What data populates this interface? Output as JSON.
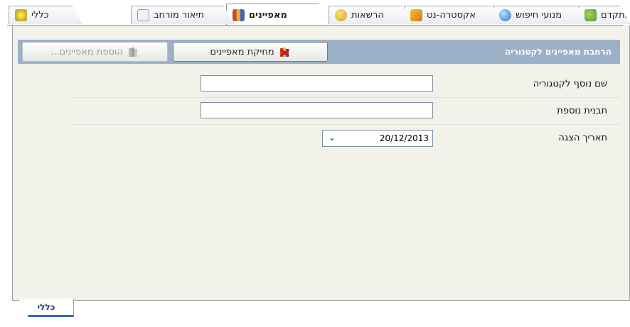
{
  "tabs": [
    {
      "label": "מתקדם",
      "icon": "puzzle-icon",
      "color": "#7fb83a"
    },
    {
      "label": "מנועי חיפוש",
      "icon": "globe-icon",
      "color": "#3a7fd0"
    },
    {
      "label": "אקסטרה-נט",
      "icon": "network-icon",
      "color": "#d99a20"
    },
    {
      "label": "הרשאות",
      "icon": "lock-icon",
      "color": "#e0b030"
    },
    {
      "label": "מאפיינים",
      "icon": "books-icon",
      "color": "#c04a2a"
    },
    {
      "label": "תיאור מורחב",
      "icon": "notepad-pencil-icon",
      "color": "#8a9ab0"
    },
    {
      "label": "כללי",
      "icon": "sparkle-icon",
      "color": "#e0c020"
    }
  ],
  "active_tab": "מאפיינים",
  "panel": {
    "title": "הרחבת מאפיינים לקטגוריה",
    "delete_button": "מחיקת מאפיינים",
    "add_button": "הוספת מאפיינים..."
  },
  "fields": {
    "extra_name": {
      "label": "שם נוסף לקטגוריה",
      "value": ""
    },
    "extra_template": {
      "label": "תבנית נוספת",
      "value": ""
    },
    "display_date": {
      "label": "תאריך הצגה",
      "value": "20/12/2013"
    }
  },
  "bottom_tab": {
    "label": "כללי"
  }
}
